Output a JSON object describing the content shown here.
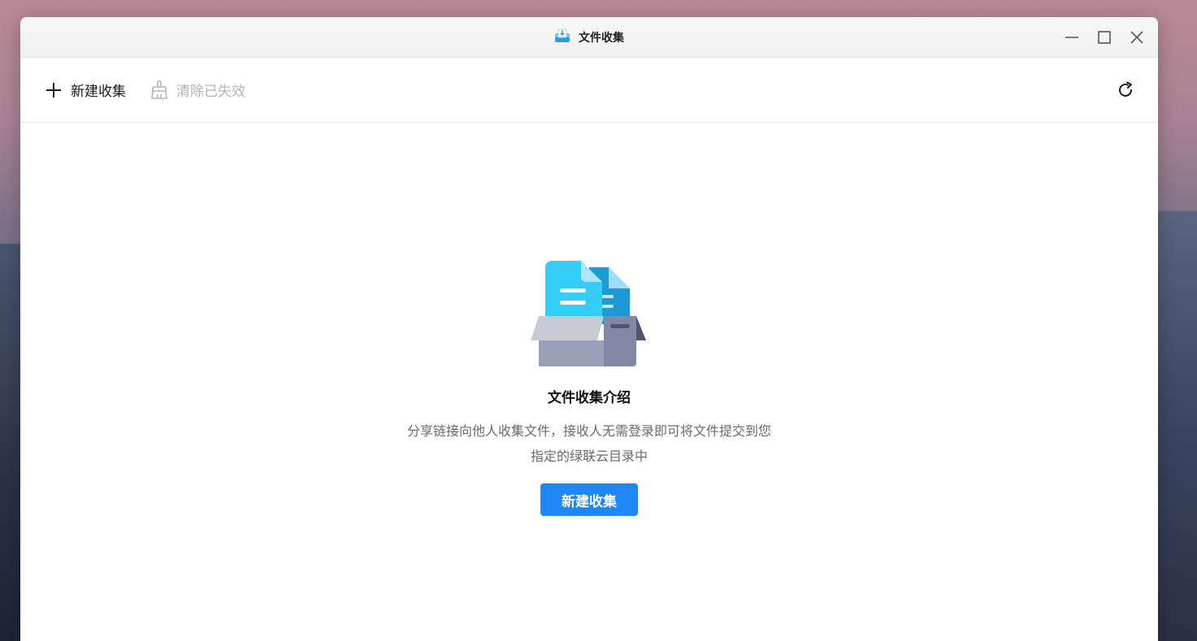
{
  "window": {
    "title": "文件收集",
    "app_icon": "inbox-download-icon",
    "controls": {
      "minimize_icon": "minimize-icon",
      "maximize_icon": "maximize-icon",
      "close_icon": "close-icon"
    }
  },
  "toolbar": {
    "new_label": "新建收集",
    "new_icon": "plus-icon",
    "clear_label": "清除已失效",
    "clear_icon": "broom-icon",
    "refresh_icon": "refresh-icon"
  },
  "empty_state": {
    "illustration": "files-in-box-icon",
    "title": "文件收集介绍",
    "desc_line1": "分享链接向他人收集文件，接收人无需登录即可将文件提交到您",
    "desc_line2": "指定的绿联云目录中",
    "cta_label": "新建收集"
  },
  "colors": {
    "accent": "#1e86f5",
    "disabled_text": "#b5b5b5",
    "muted_text": "#6b6b6b"
  }
}
